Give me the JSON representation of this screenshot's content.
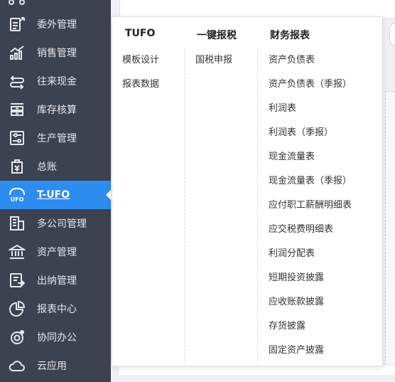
{
  "sidebar": {
    "items": [
      {
        "label": "委外管理",
        "icon": "outsource-icon"
      },
      {
        "label": "销售管理",
        "icon": "sales-chart-icon"
      },
      {
        "label": "往来现金",
        "icon": "exchange-arrows-icon"
      },
      {
        "label": "库存核算",
        "icon": "inventory-icon"
      },
      {
        "label": "生产管理",
        "icon": "production-icon"
      },
      {
        "label": "总账",
        "icon": "ledger-icon"
      },
      {
        "label": "T-UFO",
        "icon": "ufo-icon",
        "active": true
      },
      {
        "label": "多公司管理",
        "icon": "building-icon"
      },
      {
        "label": "资产管理",
        "icon": "bank-icon"
      },
      {
        "label": "出纳管理",
        "icon": "cashier-icon"
      },
      {
        "label": "报表中心",
        "icon": "pie-chart-icon"
      },
      {
        "label": "协同办公",
        "icon": "collaboration-icon"
      },
      {
        "label": "云应用",
        "icon": "cloud-icon"
      }
    ]
  },
  "dropdown": {
    "columns": [
      {
        "title": "TUFO",
        "items": [
          "模板设计",
          "报表数据"
        ]
      },
      {
        "title": "一键报税",
        "items": [
          "国税申报"
        ]
      },
      {
        "title": "财务报表",
        "items": [
          "资产负债表",
          "资产负债表（季报）",
          "利润表",
          "利润表（季报）",
          "现金流量表",
          "现金流量表（季报）",
          "应付职工薪酬明细表",
          "应交税费明细表",
          "利润分配表",
          "短期投资披露",
          "应收账款披露",
          "存货披露",
          "固定资产披露"
        ]
      }
    ]
  },
  "colors": {
    "sidebar_bg": "#3b4250",
    "active_bg": "#2d8cf0"
  }
}
